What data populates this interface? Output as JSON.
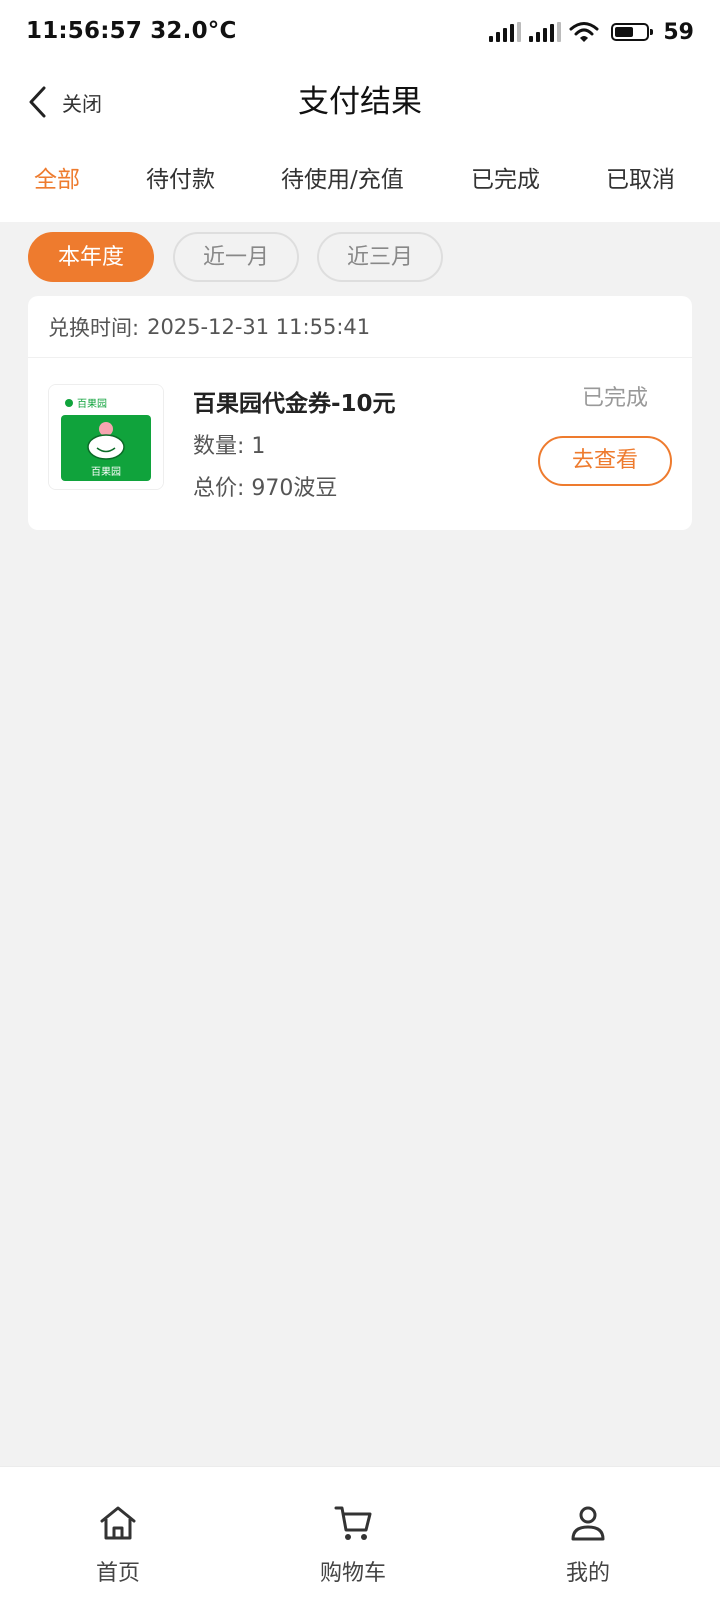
{
  "status_bar": {
    "time": "11:56:57 32.0°C",
    "battery": "59",
    "battery_level": 0.59
  },
  "header": {
    "close_label": "关闭",
    "title": "支付结果"
  },
  "tabs": [
    {
      "label": "全部",
      "active": true
    },
    {
      "label": "待付款",
      "active": false
    },
    {
      "label": "待使用/充值",
      "active": false
    },
    {
      "label": "已完成",
      "active": false
    },
    {
      "label": "已取消",
      "active": false
    }
  ],
  "filters": [
    {
      "label": "本年度",
      "active": true
    },
    {
      "label": "近一月",
      "active": false
    },
    {
      "label": "近三月",
      "active": false
    }
  ],
  "order": {
    "time_label": "兑换时间:",
    "time_value": "2025-12-31 11:55:41",
    "status": "已完成",
    "product_name": "百果园代金券-10元",
    "quantity": "数量: 1",
    "total": "总价: 970波豆",
    "view_button": "去查看",
    "thumb_brand_small": "百果园",
    "thumb_brand": "百果园"
  },
  "bottom_nav": [
    {
      "label": "首页",
      "icon": "home-icon"
    },
    {
      "label": "购物车",
      "icon": "cart-icon"
    },
    {
      "label": "我的",
      "icon": "user-icon"
    }
  ],
  "colors": {
    "accent": "#ee7b2e",
    "background": "#f2f2f2",
    "brand_green": "#10a33c"
  }
}
